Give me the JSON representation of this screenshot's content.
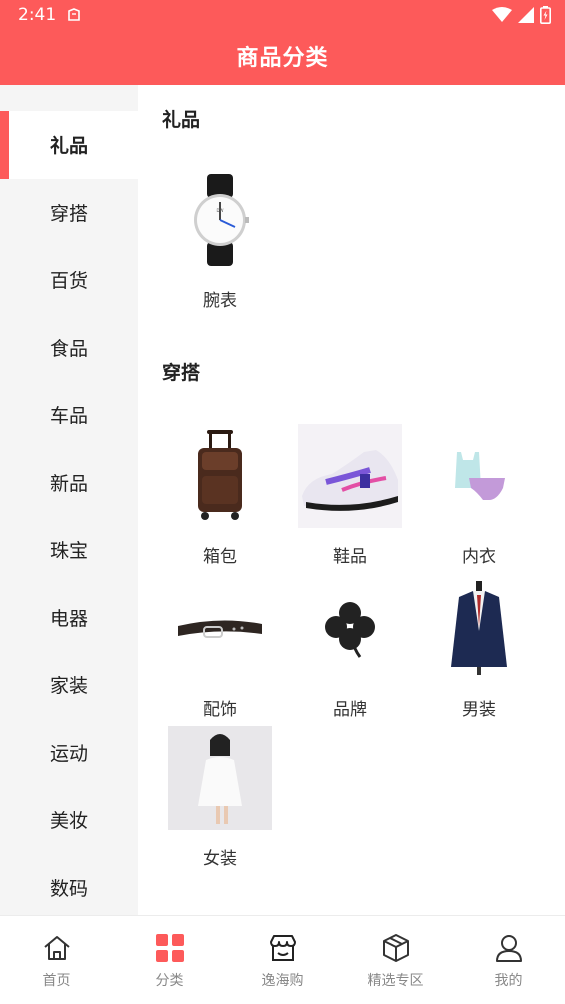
{
  "status_bar": {
    "time": "2:41"
  },
  "header": {
    "title": "商品分类"
  },
  "sidebar": {
    "items": [
      {
        "label": "礼品",
        "active": true
      },
      {
        "label": "穿搭"
      },
      {
        "label": "百货"
      },
      {
        "label": "食品"
      },
      {
        "label": "车品"
      },
      {
        "label": "新品"
      },
      {
        "label": "珠宝"
      },
      {
        "label": "电器"
      },
      {
        "label": "家装"
      },
      {
        "label": "运动"
      },
      {
        "label": "美妆"
      },
      {
        "label": "数码"
      }
    ]
  },
  "sections": [
    {
      "title": "礼品",
      "items": [
        {
          "label": "腕表",
          "icon": "watch-image"
        }
      ]
    },
    {
      "title": "穿搭",
      "items": [
        {
          "label": "箱包",
          "icon": "luggage-image"
        },
        {
          "label": "鞋品",
          "icon": "sneaker-image"
        },
        {
          "label": "内衣",
          "icon": "underwear-image"
        },
        {
          "label": "配饰",
          "icon": "belt-image"
        },
        {
          "label": "品牌",
          "icon": "clover-image"
        },
        {
          "label": "男装",
          "icon": "suit-image"
        },
        {
          "label": "女装",
          "icon": "dress-image"
        }
      ]
    }
  ],
  "tabbar": {
    "tabs": [
      {
        "label": "首页",
        "icon": "home-icon"
      },
      {
        "label": "分类",
        "icon": "category-icon",
        "active": true
      },
      {
        "label": "逸海购",
        "icon": "store-icon"
      },
      {
        "label": "精选专区",
        "icon": "box-icon"
      },
      {
        "label": "我的",
        "icon": "user-icon"
      }
    ]
  },
  "colors": {
    "accent": "#fd5a5a",
    "sidebar_bg": "#f5f5f5"
  }
}
